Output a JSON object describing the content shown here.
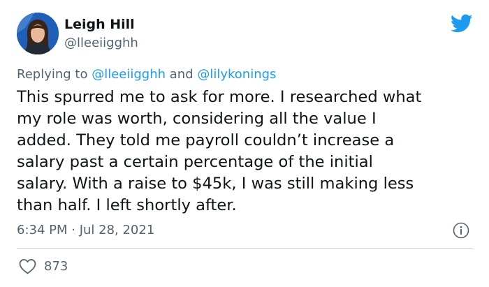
{
  "author": {
    "display_name": "Leigh Hill",
    "handle": "@lleeiigghh"
  },
  "reply_context": {
    "prefix": "Replying to ",
    "mention_1": "@lleeiigghh",
    "conjunction": " and ",
    "mention_2": "@lilykonings"
  },
  "tweet": {
    "text": "This spurred me to ask for more. I researched what\nmy role was worth, considering all the value I\nadded. They told me payroll couldn’t increase a\nsalary past a certain percentage of the initial\nsalary. With a raise to $45k, I was still making less\nthan half. I left shortly after.",
    "timestamp": "6:34 PM · Jul 28, 2021"
  },
  "engagement": {
    "likes": "873"
  },
  "icons": {
    "brand": "twitter-bird-icon",
    "info": "info-icon",
    "like": "heart-icon"
  },
  "colors": {
    "brand_blue": "#1d9bf0",
    "text": "#0f1419",
    "secondary_text": "#536471",
    "divider": "#cfd9de"
  }
}
